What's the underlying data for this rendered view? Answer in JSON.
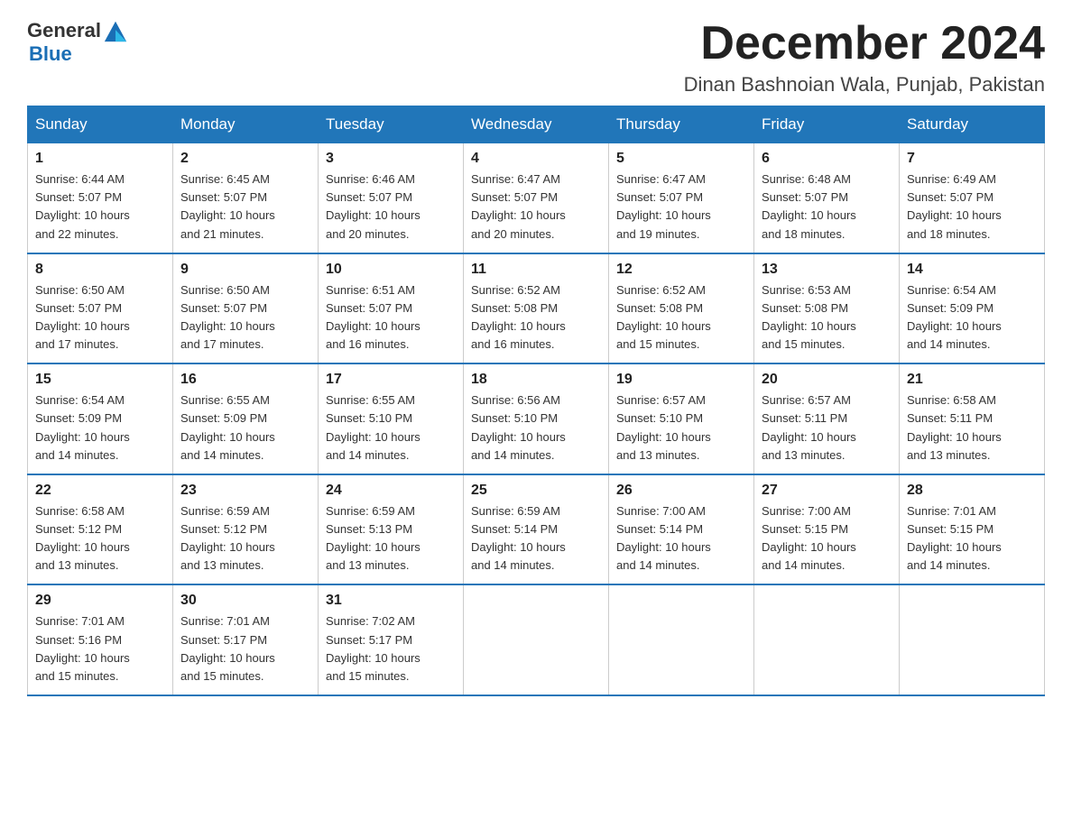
{
  "header": {
    "logo_general": "General",
    "logo_blue": "Blue",
    "month_title": "December 2024",
    "location": "Dinan Bashnoian Wala, Punjab, Pakistan"
  },
  "days_of_week": [
    "Sunday",
    "Monday",
    "Tuesday",
    "Wednesday",
    "Thursday",
    "Friday",
    "Saturday"
  ],
  "weeks": [
    [
      {
        "day": "1",
        "sunrise": "6:44 AM",
        "sunset": "5:07 PM",
        "daylight": "10 hours and 22 minutes."
      },
      {
        "day": "2",
        "sunrise": "6:45 AM",
        "sunset": "5:07 PM",
        "daylight": "10 hours and 21 minutes."
      },
      {
        "day": "3",
        "sunrise": "6:46 AM",
        "sunset": "5:07 PM",
        "daylight": "10 hours and 20 minutes."
      },
      {
        "day": "4",
        "sunrise": "6:47 AM",
        "sunset": "5:07 PM",
        "daylight": "10 hours and 20 minutes."
      },
      {
        "day": "5",
        "sunrise": "6:47 AM",
        "sunset": "5:07 PM",
        "daylight": "10 hours and 19 minutes."
      },
      {
        "day": "6",
        "sunrise": "6:48 AM",
        "sunset": "5:07 PM",
        "daylight": "10 hours and 18 minutes."
      },
      {
        "day": "7",
        "sunrise": "6:49 AM",
        "sunset": "5:07 PM",
        "daylight": "10 hours and 18 minutes."
      }
    ],
    [
      {
        "day": "8",
        "sunrise": "6:50 AM",
        "sunset": "5:07 PM",
        "daylight": "10 hours and 17 minutes."
      },
      {
        "day": "9",
        "sunrise": "6:50 AM",
        "sunset": "5:07 PM",
        "daylight": "10 hours and 17 minutes."
      },
      {
        "day": "10",
        "sunrise": "6:51 AM",
        "sunset": "5:07 PM",
        "daylight": "10 hours and 16 minutes."
      },
      {
        "day": "11",
        "sunrise": "6:52 AM",
        "sunset": "5:08 PM",
        "daylight": "10 hours and 16 minutes."
      },
      {
        "day": "12",
        "sunrise": "6:52 AM",
        "sunset": "5:08 PM",
        "daylight": "10 hours and 15 minutes."
      },
      {
        "day": "13",
        "sunrise": "6:53 AM",
        "sunset": "5:08 PM",
        "daylight": "10 hours and 15 minutes."
      },
      {
        "day": "14",
        "sunrise": "6:54 AM",
        "sunset": "5:09 PM",
        "daylight": "10 hours and 14 minutes."
      }
    ],
    [
      {
        "day": "15",
        "sunrise": "6:54 AM",
        "sunset": "5:09 PM",
        "daylight": "10 hours and 14 minutes."
      },
      {
        "day": "16",
        "sunrise": "6:55 AM",
        "sunset": "5:09 PM",
        "daylight": "10 hours and 14 minutes."
      },
      {
        "day": "17",
        "sunrise": "6:55 AM",
        "sunset": "5:10 PM",
        "daylight": "10 hours and 14 minutes."
      },
      {
        "day": "18",
        "sunrise": "6:56 AM",
        "sunset": "5:10 PM",
        "daylight": "10 hours and 14 minutes."
      },
      {
        "day": "19",
        "sunrise": "6:57 AM",
        "sunset": "5:10 PM",
        "daylight": "10 hours and 13 minutes."
      },
      {
        "day": "20",
        "sunrise": "6:57 AM",
        "sunset": "5:11 PM",
        "daylight": "10 hours and 13 minutes."
      },
      {
        "day": "21",
        "sunrise": "6:58 AM",
        "sunset": "5:11 PM",
        "daylight": "10 hours and 13 minutes."
      }
    ],
    [
      {
        "day": "22",
        "sunrise": "6:58 AM",
        "sunset": "5:12 PM",
        "daylight": "10 hours and 13 minutes."
      },
      {
        "day": "23",
        "sunrise": "6:59 AM",
        "sunset": "5:12 PM",
        "daylight": "10 hours and 13 minutes."
      },
      {
        "day": "24",
        "sunrise": "6:59 AM",
        "sunset": "5:13 PM",
        "daylight": "10 hours and 13 minutes."
      },
      {
        "day": "25",
        "sunrise": "6:59 AM",
        "sunset": "5:14 PM",
        "daylight": "10 hours and 14 minutes."
      },
      {
        "day": "26",
        "sunrise": "7:00 AM",
        "sunset": "5:14 PM",
        "daylight": "10 hours and 14 minutes."
      },
      {
        "day": "27",
        "sunrise": "7:00 AM",
        "sunset": "5:15 PM",
        "daylight": "10 hours and 14 minutes."
      },
      {
        "day": "28",
        "sunrise": "7:01 AM",
        "sunset": "5:15 PM",
        "daylight": "10 hours and 14 minutes."
      }
    ],
    [
      {
        "day": "29",
        "sunrise": "7:01 AM",
        "sunset": "5:16 PM",
        "daylight": "10 hours and 15 minutes."
      },
      {
        "day": "30",
        "sunrise": "7:01 AM",
        "sunset": "5:17 PM",
        "daylight": "10 hours and 15 minutes."
      },
      {
        "day": "31",
        "sunrise": "7:02 AM",
        "sunset": "5:17 PM",
        "daylight": "10 hours and 15 minutes."
      },
      null,
      null,
      null,
      null
    ]
  ],
  "labels": {
    "sunrise": "Sunrise:",
    "sunset": "Sunset:",
    "daylight": "Daylight:"
  }
}
